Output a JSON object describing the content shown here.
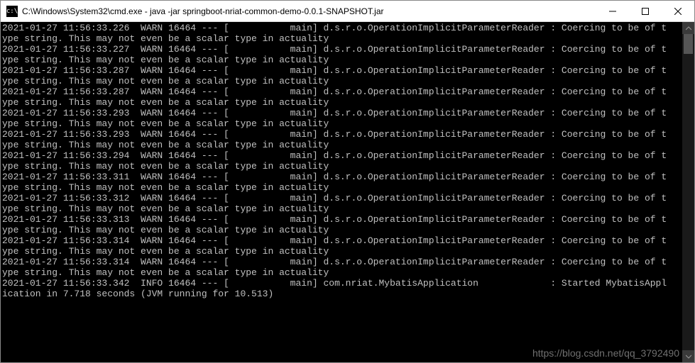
{
  "window": {
    "title": "C:\\Windows\\System32\\cmd.exe - java  -jar springboot-nriat-common-demo-0.0.1-SNAPSHOT.jar",
    "icon_label": "cmd-icon"
  },
  "watermark": "https://blog.csdn.net/qq_3792490",
  "log": {
    "warn_wrap": "ype string. This may not even be a scalar type in actuality",
    "lines": [
      {
        "ts": "2021-01-27 11:56:33.226",
        "level": "WARN",
        "pid": "16464",
        "main_pad": "          main",
        "tail": "d.s.r.o.OperationImplicitParameterReader : Coercing to be of t"
      },
      {
        "ts": "2021-01-27 11:56:33.227",
        "level": "WARN",
        "pid": "16464",
        "main_pad": "          main",
        "tail": "d.s.r.o.OperationImplicitParameterReader : Coercing to be of t"
      },
      {
        "ts": "2021-01-27 11:56:33.287",
        "level": "WARN",
        "pid": "16464",
        "main_pad": "          main",
        "tail": "d.s.r.o.OperationImplicitParameterReader : Coercing to be of t"
      },
      {
        "ts": "2021-01-27 11:56:33.287",
        "level": "WARN",
        "pid": "16464",
        "main_pad": "          main",
        "tail": "d.s.r.o.OperationImplicitParameterReader : Coercing to be of t"
      },
      {
        "ts": "2021-01-27 11:56:33.293",
        "level": "WARN",
        "pid": "16464",
        "main_pad": "          main",
        "tail": "d.s.r.o.OperationImplicitParameterReader : Coercing to be of t"
      },
      {
        "ts": "2021-01-27 11:56:33.293",
        "level": "WARN",
        "pid": "16464",
        "main_pad": "          main",
        "tail": "d.s.r.o.OperationImplicitParameterReader : Coercing to be of t"
      },
      {
        "ts": "2021-01-27 11:56:33.294",
        "level": "WARN",
        "pid": "16464",
        "main_pad": "          main",
        "tail": "d.s.r.o.OperationImplicitParameterReader : Coercing to be of t"
      },
      {
        "ts": "2021-01-27 11:56:33.311",
        "level": "WARN",
        "pid": "16464",
        "main_pad": "          main",
        "tail": "d.s.r.o.OperationImplicitParameterReader : Coercing to be of t"
      },
      {
        "ts": "2021-01-27 11:56:33.312",
        "level": "WARN",
        "pid": "16464",
        "main_pad": "          main",
        "tail": "d.s.r.o.OperationImplicitParameterReader : Coercing to be of t"
      },
      {
        "ts": "2021-01-27 11:56:33.313",
        "level": "WARN",
        "pid": "16464",
        "main_pad": "          main",
        "tail": "d.s.r.o.OperationImplicitParameterReader : Coercing to be of t"
      },
      {
        "ts": "2021-01-27 11:56:33.314",
        "level": "WARN",
        "pid": "16464",
        "main_pad": "          main",
        "tail": "d.s.r.o.OperationImplicitParameterReader : Coercing to be of t"
      },
      {
        "ts": "2021-01-27 11:56:33.314",
        "level": "WARN",
        "pid": "16464",
        "main_pad": "          main",
        "tail": "d.s.r.o.OperationImplicitParameterReader : Coercing to be of t"
      }
    ],
    "info_line": {
      "ts": "2021-01-27 11:56:33.342",
      "level": "INFO",
      "pid": "16464",
      "main_pad": "          main",
      "tail": "com.nriat.MybatisApplication             : Started MybatisAppl"
    },
    "info_wrap": "ication in 7.718 seconds (JVM running for 10.513)"
  }
}
